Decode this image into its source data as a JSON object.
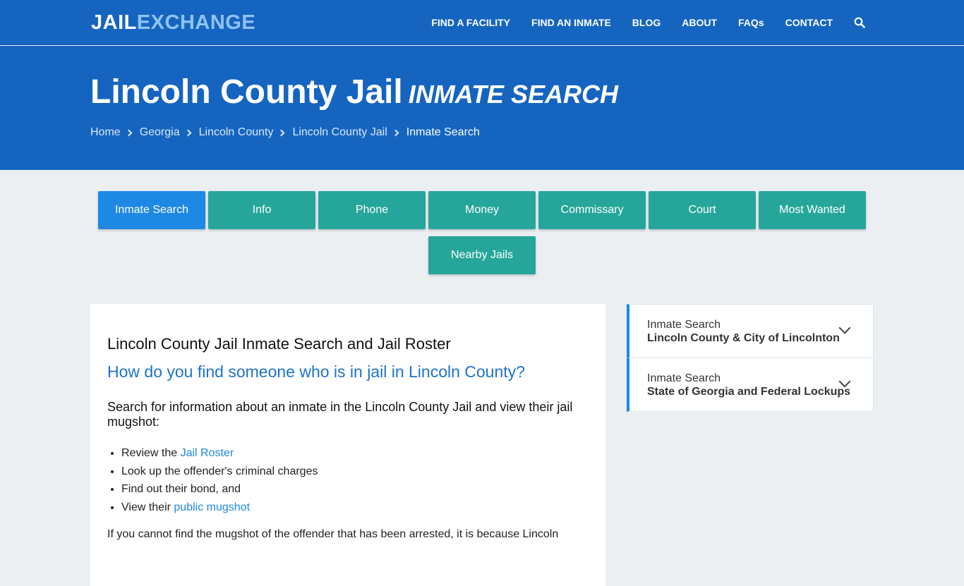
{
  "header": {
    "logo_part1": "JAIL",
    "logo_part2": "EXCHANGE",
    "nav": [
      "FIND A FACILITY",
      "FIND AN INMATE",
      "BLOG",
      "ABOUT",
      "FAQs",
      "CONTACT"
    ],
    "search_icon": "search-icon"
  },
  "hero": {
    "title": "Lincoln County Jail",
    "subtitle": "INMATE SEARCH",
    "breadcrumbs": [
      "Home",
      "Georgia",
      "Lincoln County",
      "Lincoln County Jail",
      "Inmate Search"
    ]
  },
  "tabs": [
    "Inmate Search",
    "Info",
    "Phone",
    "Money",
    "Commissary",
    "Court",
    "Most Wanted",
    "Nearby Jails"
  ],
  "main": {
    "heading": "Lincoln County Jail Inmate Search and Jail Roster",
    "subheading": "How do you find someone who is in jail in Lincoln County?",
    "intro": "Search for information about an inmate in the Lincoln County Jail and view their jail mugshot:",
    "list": {
      "item1_prefix": "Review the ",
      "item1_link": "Jail Roster",
      "item2": "Look up the offender's criminal charges",
      "item3": "Find out their bond, and",
      "item4_prefix": "View their ",
      "item4_link": "public mugshot"
    },
    "para": "If you cannot find the mugshot of the offender that has been arrested, it is because Lincoln"
  },
  "sidebar": {
    "items": [
      {
        "title": "Inmate Search",
        "subtitle": "Lincoln County & City of Lincolnton"
      },
      {
        "title": "Inmate Search",
        "subtitle": "State of Georgia and Federal Lockups"
      }
    ]
  },
  "colors": {
    "brand_blue": "#1565c0",
    "tab_teal": "#26a69a",
    "tab_active": "#1e88e5",
    "link": "#1e88e5"
  }
}
